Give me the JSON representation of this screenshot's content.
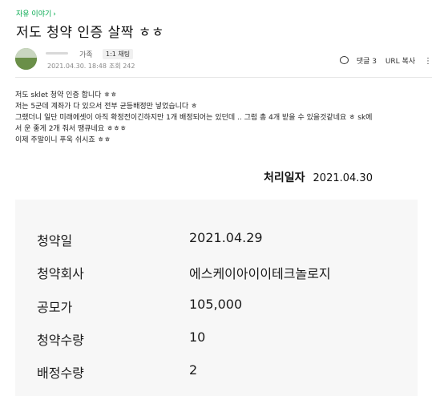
{
  "cafe": {
    "board_link": "자유 이야기",
    "chevron": "›"
  },
  "post": {
    "title": "저도 청약 인증 살짝 ㅎㅎ",
    "author": {
      "role": "가족",
      "chat_badge": "1:1 채팅",
      "datetime": "2021.04.30. 18:48",
      "views_label": "조회 242"
    },
    "actions": {
      "comments": "댓글 3",
      "url_copy": "URL 복사",
      "more": "⋮"
    },
    "body_lines": [
      "저도 sklet 청약 인증 합니다 ㅎㅎ",
      "저는 5군데 계좌가 다 있으서 전부 균등배정만 넣었습니다 ㅎ",
      "그랬더니 일단 미래에셋이 아직 확정전이긴하지만 1개 배정되어는 있던데 .. 그럼 총 4개 받을 수 있을것같네요 ㅎ sk에",
      "서 운 좋게 2개 줘서 땡큐네요 ㅎㅎㅎ",
      "이제 주말이니 푸욱 쉬시죠 ㅎㅎ"
    ]
  },
  "subscription": {
    "processed_label": "처리일자",
    "processed_date": "2021.04.30",
    "rows": [
      {
        "key": "청약일",
        "value": "2021.04.29"
      },
      {
        "key": "청약회사",
        "value": "에스케이아이이테크놀로지"
      },
      {
        "key": "공모가",
        "value": "105,000"
      },
      {
        "key": "청약수량",
        "value": "10"
      },
      {
        "key": "배정수량",
        "value": "2"
      }
    ]
  },
  "colors": {
    "accent_green": "#03a94e",
    "panel_bg": "#f7f7f7"
  }
}
